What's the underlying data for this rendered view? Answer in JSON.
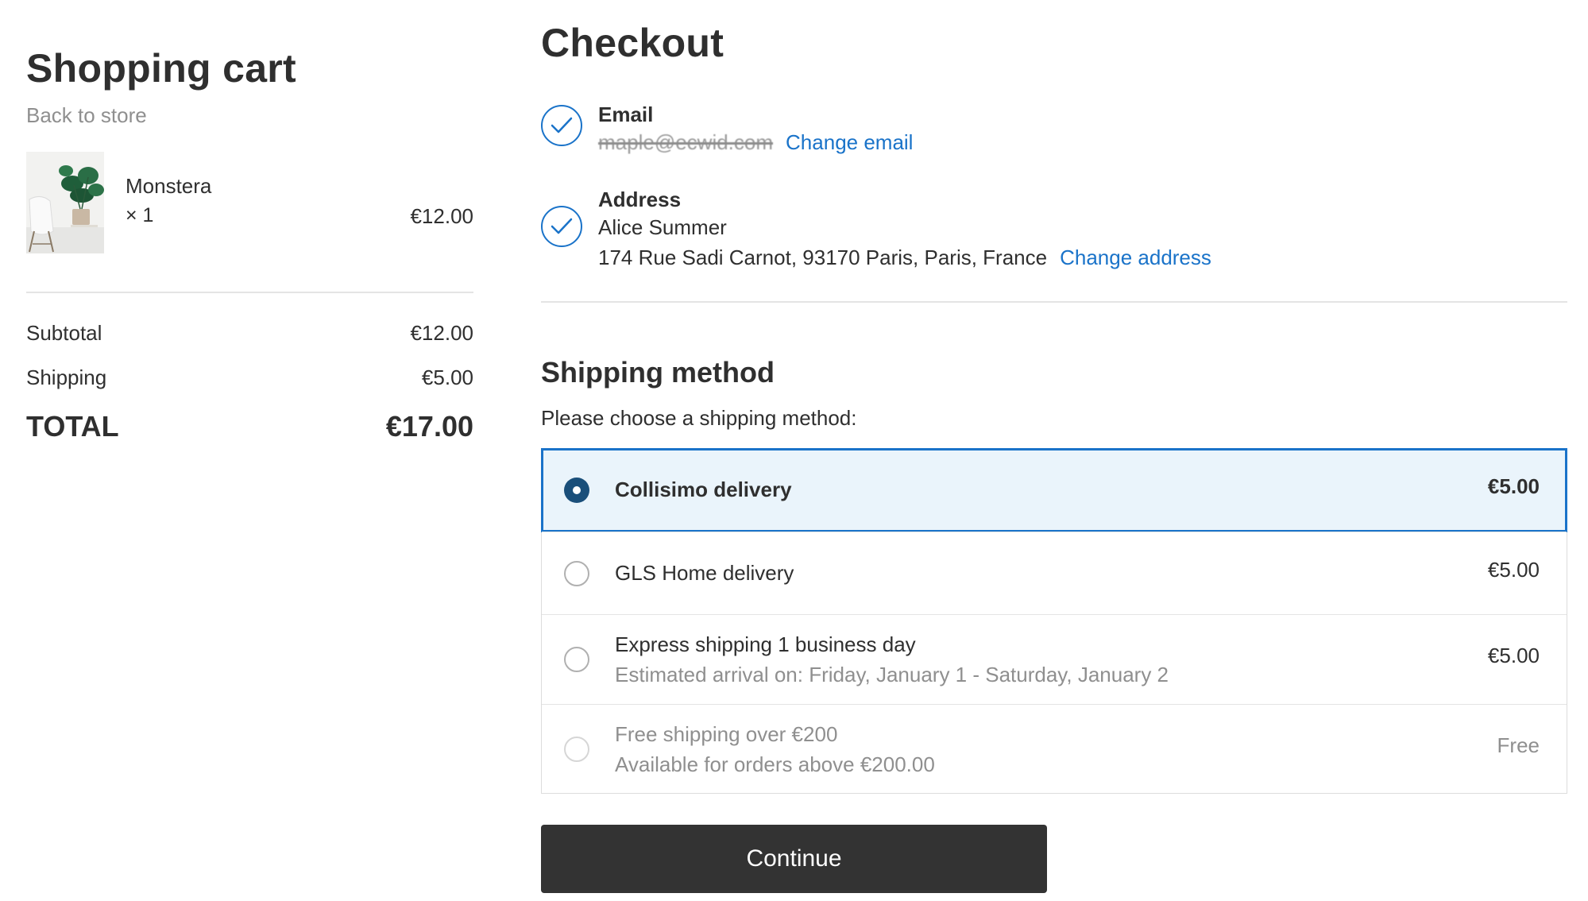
{
  "cart": {
    "title": "Shopping cart",
    "back_link": "Back to store",
    "item": {
      "name": "Monstera",
      "qty": "× 1",
      "price": "€12.00"
    },
    "subtotal_label": "Subtotal",
    "subtotal_value": "€12.00",
    "shipping_label": "Shipping",
    "shipping_value": "€5.00",
    "total_label": "TOTAL",
    "total_value": "€17.00"
  },
  "checkout": {
    "title": "Checkout",
    "email": {
      "label": "Email",
      "value": "maple@ecwid.com",
      "change_link": "Change email"
    },
    "address": {
      "label": "Address",
      "name": "Alice Summer",
      "line": "174 Rue Sadi Carnot, 93170 Paris, Paris, France",
      "change_link": "Change address"
    },
    "shipping": {
      "heading": "Shipping method",
      "subheading": "Please choose a shipping method:",
      "options": [
        {
          "name": "Collisimo delivery",
          "detail": "",
          "price": "€5.00",
          "selected": true,
          "disabled": false
        },
        {
          "name": "GLS Home delivery",
          "detail": "",
          "price": "€5.00",
          "selected": false,
          "disabled": false
        },
        {
          "name": "Express shipping 1 business day",
          "detail": "Estimated arrival on: Friday, January 1 - Saturday, January 2",
          "price": "€5.00",
          "selected": false,
          "disabled": false
        },
        {
          "name": "Free shipping over €200",
          "detail": "Available for orders above €200.00",
          "price": "Free",
          "selected": false,
          "disabled": true
        }
      ]
    },
    "continue_label": "Continue"
  },
  "icons": {
    "check": "check-icon",
    "radio": "radio-icon",
    "product": "monstera-plant-image"
  },
  "colors": {
    "accent": "#1a73c9",
    "selected_bg": "#eaf4fb",
    "button_bg": "#333333",
    "radio_on": "#1a4f7a"
  }
}
